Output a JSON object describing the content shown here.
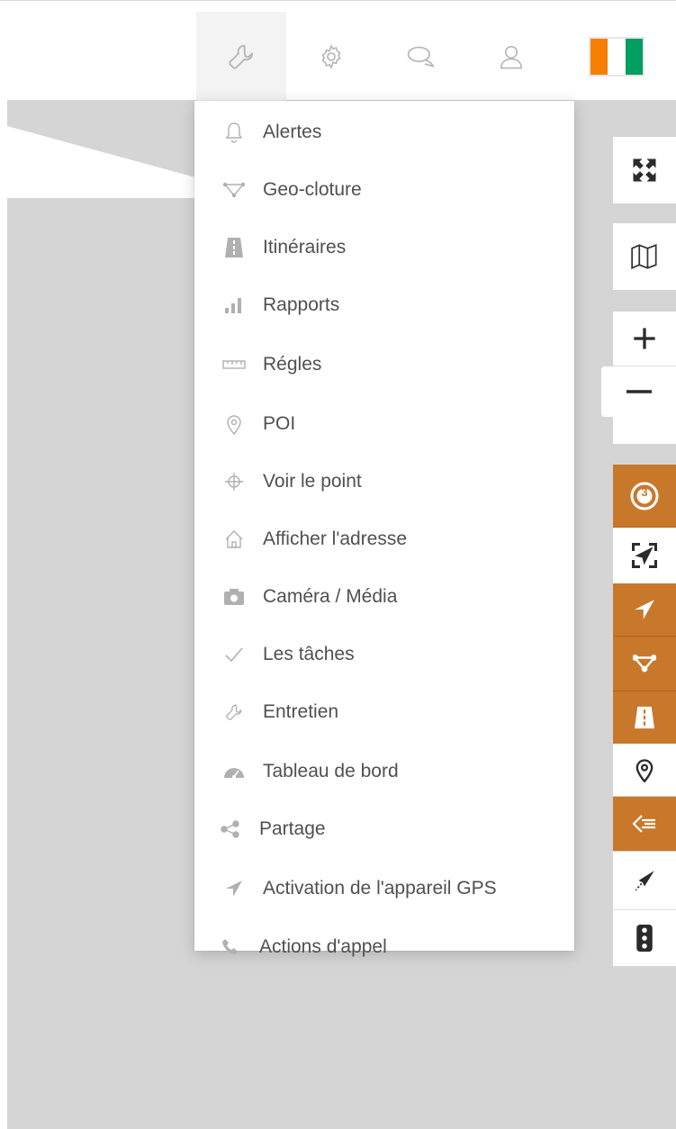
{
  "colors": {
    "accent": "#c8782b",
    "menu_text": "#505050",
    "menu_icon": "#b0b0b0",
    "map_bg": "#d5d5d5",
    "flag": [
      "#f77f00",
      "#ffffff",
      "#009e60"
    ]
  },
  "toolbar": {
    "icons": [
      "wrench-icon",
      "gear-icon",
      "chat-icon",
      "user-icon",
      "flag-icon"
    ]
  },
  "tools_menu": {
    "items": [
      {
        "icon": "bell-icon",
        "label": "Alertes"
      },
      {
        "icon": "geofence-icon",
        "label": "Geo-cloture"
      },
      {
        "icon": "road-icon",
        "label": "Itinéraires"
      },
      {
        "icon": "bar-chart-icon",
        "label": "Rapports"
      },
      {
        "icon": "ruler-icon",
        "label": "Régles"
      },
      {
        "icon": "map-pin-icon",
        "label": "POI"
      },
      {
        "icon": "crosshair-icon",
        "label": "Voir le point"
      },
      {
        "icon": "home-icon",
        "label": "Afficher l'adresse"
      },
      {
        "icon": "camera-icon",
        "label": "Caméra / Média"
      },
      {
        "icon": "check-icon",
        "label": "Les tâches"
      },
      {
        "icon": "wrench-icon",
        "label": "Entretien"
      },
      {
        "icon": "dashboard-icon",
        "label": "Tableau de bord"
      },
      {
        "icon": "share-icon",
        "label": "Partage"
      },
      {
        "icon": "navigation-arrow-icon",
        "label": "Activation de l'appareil GPS"
      },
      {
        "icon": "phone-icon",
        "label": "Actions d'appel"
      }
    ]
  },
  "map_controls": {
    "buttons": [
      "fullscreen-icon",
      "map-layers-icon",
      "zoom-in-icon",
      "zoom-out-icon",
      "cluster-icon",
      "fit-bounds-icon",
      "navigation-arrow-icon",
      "geofence-icon",
      "road-icon",
      "map-pin-icon",
      "collapse-list-icon",
      "route-arrow-icon",
      "traffic-light-icon"
    ],
    "cluster_count": "3"
  }
}
